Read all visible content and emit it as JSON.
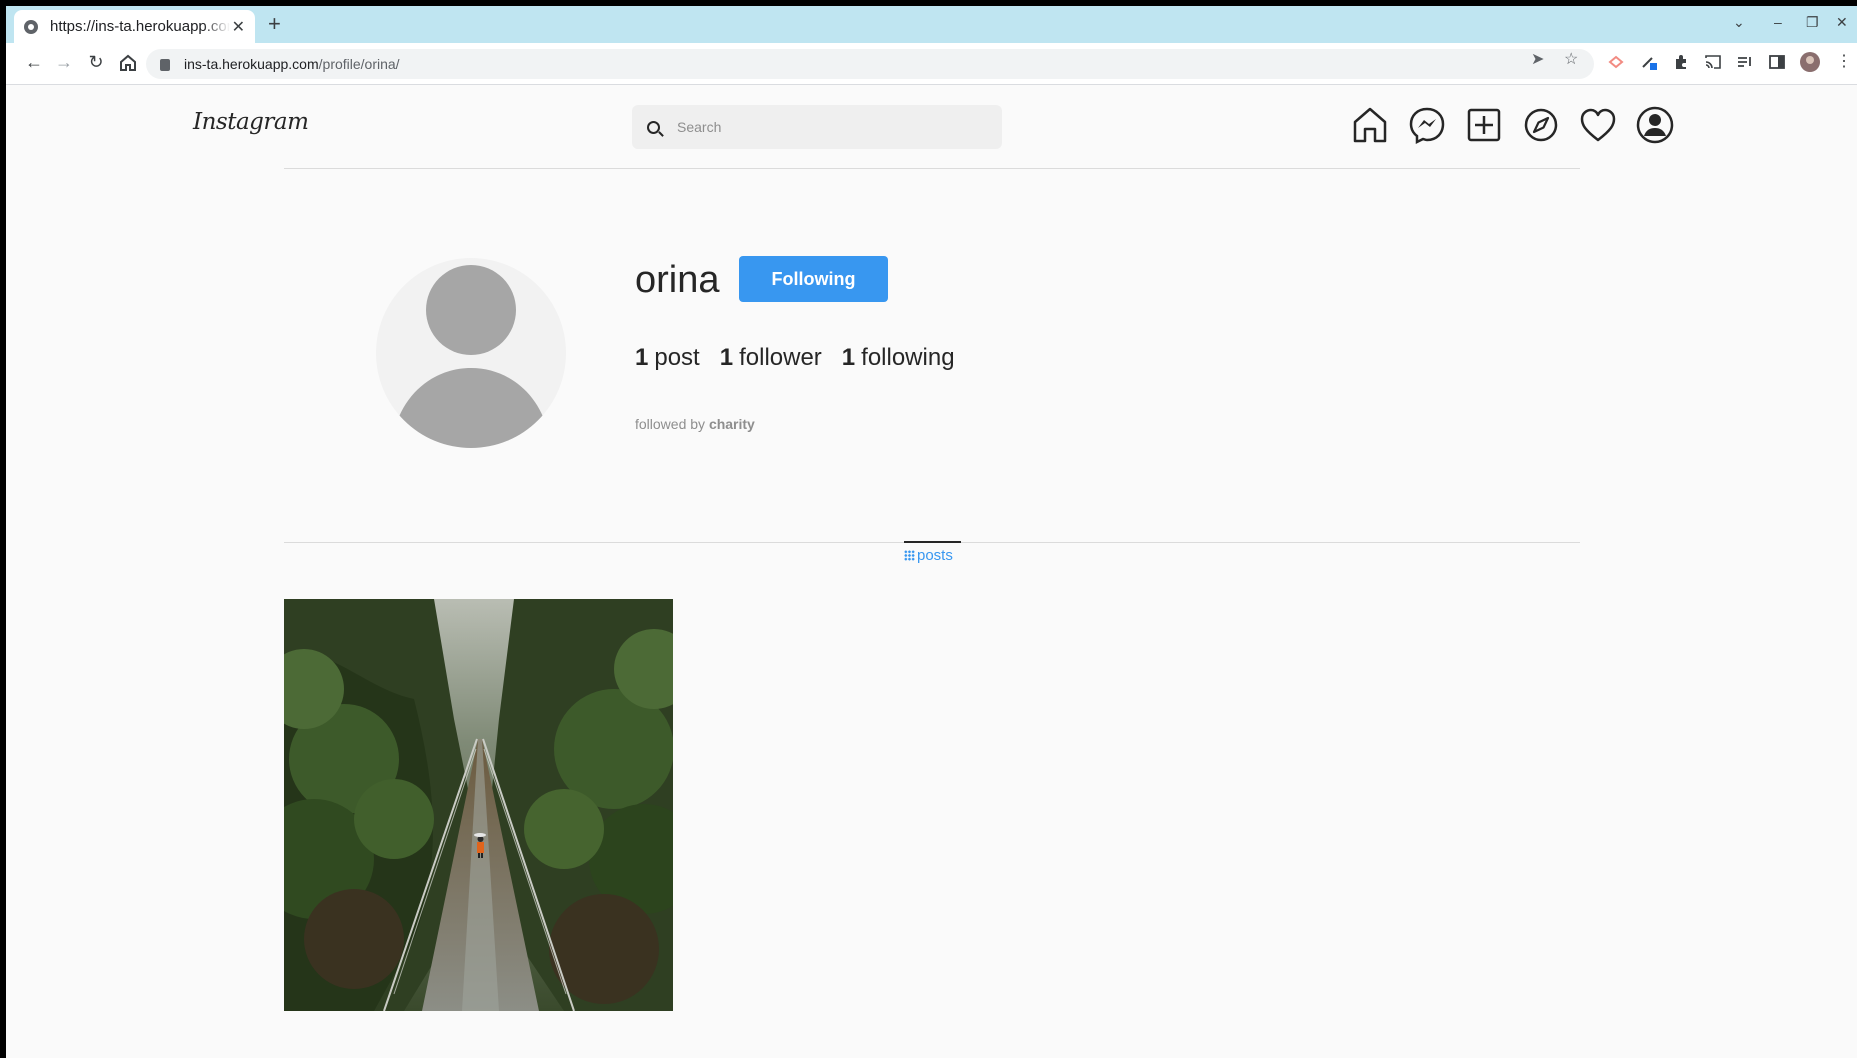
{
  "browser": {
    "tab_title": "https://ins-ta.herokuapp.com/profile/orina/",
    "url_host": "ins-ta.herokuapp.com",
    "url_path": "/profile/orina/"
  },
  "header": {
    "logo": "Instagram",
    "search_placeholder": "Search"
  },
  "profile": {
    "username": "orina",
    "follow_button": "Following",
    "posts_count": "1",
    "posts_label": "post",
    "followers_count": "1",
    "followers_label": "follower",
    "following_count": "1",
    "following_label": "following",
    "followed_by_prefix": "followed by",
    "followed_by_user": "charity"
  },
  "tabs": {
    "posts": "posts"
  },
  "colors": {
    "accent": "#3897f0",
    "text": "#262626",
    "muted": "#8e8e8e"
  }
}
